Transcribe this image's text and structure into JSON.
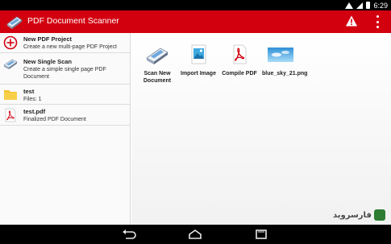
{
  "status_bar": {
    "time": "6:29"
  },
  "app": {
    "title": "PDF Document Scanner",
    "accent_color": "#d2000f"
  },
  "sidebar": {
    "items": [
      {
        "title": "New PDF Project",
        "subtitle": "Create a new multi-page PDF Project",
        "icon": "add-circle-icon"
      },
      {
        "title": "New Single Scan",
        "subtitle": "Create a simple single page PDF Document",
        "icon": "scanner-icon"
      },
      {
        "title": "test",
        "subtitle": "Files: 1",
        "icon": "folder-icon"
      },
      {
        "title": "test.pdf",
        "subtitle": "Finalized PDF Document",
        "icon": "pdf-file-icon"
      }
    ]
  },
  "actions": [
    {
      "label": "Scan New Document",
      "icon": "scanner-icon"
    },
    {
      "label": "Import Image",
      "icon": "image-icon"
    },
    {
      "label": "Compile PDF",
      "icon": "pdf-icon"
    },
    {
      "label": "blue_sky_21.png",
      "icon": "image-thumbnail"
    }
  ],
  "watermark": {
    "text": "فارسروید"
  }
}
